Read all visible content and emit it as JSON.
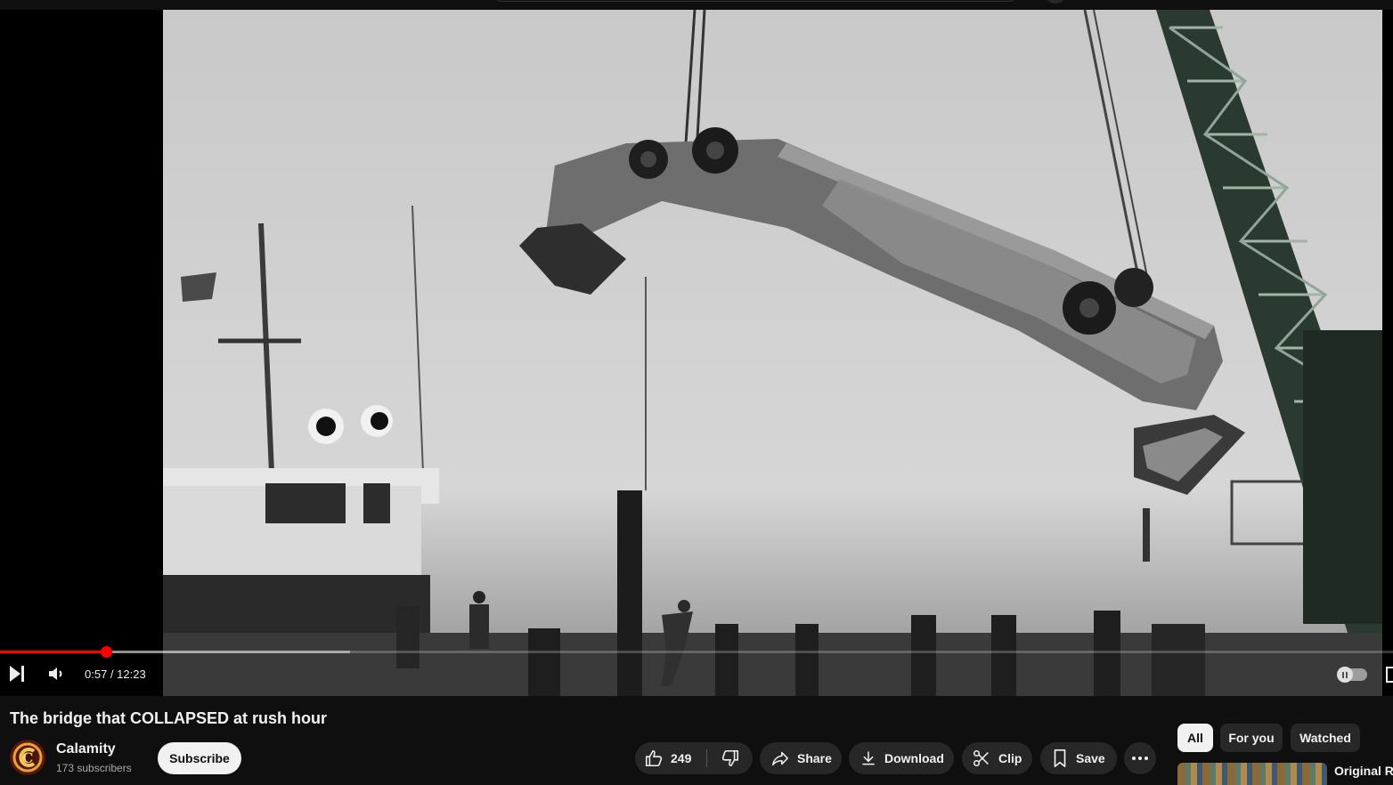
{
  "player": {
    "current_time": "0:57",
    "duration": "12:23",
    "time_separator": " / ",
    "played_fraction": 0.0767,
    "buffered_fraction": 0.2514,
    "accent_color": "#ff0000"
  },
  "video": {
    "title": "The bridge that COLLAPSED at rush hour"
  },
  "channel": {
    "name": "Calamity",
    "subscribers": "173 subscribers",
    "avatar_letter": "C"
  },
  "actions": {
    "subscribe_label": "Subscribe",
    "like_count": "249",
    "share_label": "Share",
    "download_label": "Download",
    "clip_label": "Clip",
    "save_label": "Save"
  },
  "icons": {
    "play_next": "next-icon",
    "volume": "volume-icon",
    "like": "thumbs-up-icon",
    "dislike": "thumbs-down-icon",
    "share": "share-arrow-icon",
    "download": "download-icon",
    "clip": "scissors-icon",
    "save": "bookmark-icon",
    "more": "more-horizontal-icon"
  },
  "filters": {
    "chips": [
      "All",
      "For you",
      "Watched"
    ],
    "active": "All"
  },
  "recommendation": {
    "title": "Original Ra"
  }
}
